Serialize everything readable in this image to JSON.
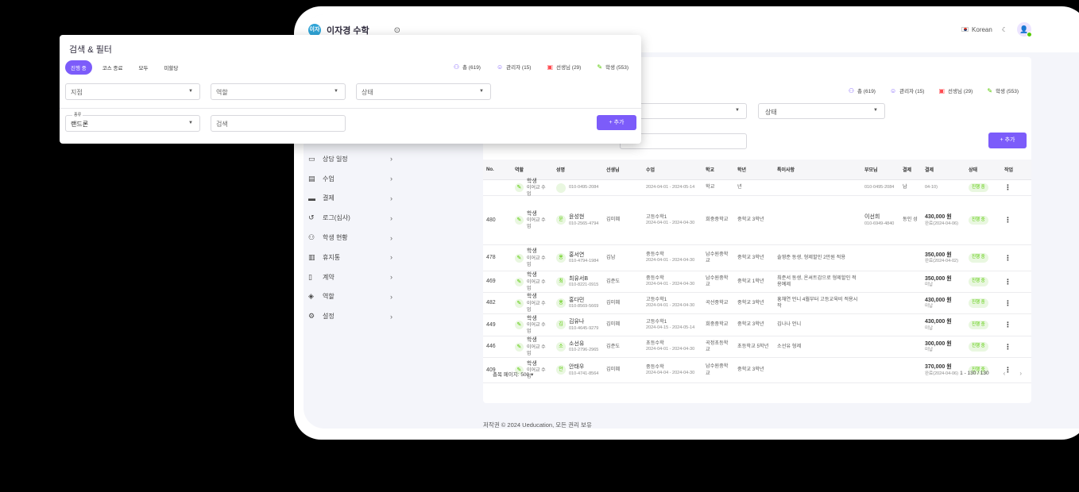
{
  "app": {
    "title": "이자경 수학",
    "logo_text": "이자경",
    "language": "Korean",
    "footer": "저작권 © 2024 Ueducation, 모든 권리 보유"
  },
  "colors": {
    "accent": "#7c5cfa",
    "success": "#56ca00",
    "error": "#ff4c51",
    "info": "#16b1ff"
  },
  "sidebar": {
    "items": [
      {
        "label": "상담 일정",
        "icon": "calendar-icon"
      },
      {
        "label": "수업",
        "icon": "book-icon"
      },
      {
        "label": "결제",
        "icon": "card-icon"
      },
      {
        "label": "로그(심사)",
        "icon": "history-icon"
      },
      {
        "label": "학생 현황",
        "icon": "users-icon"
      },
      {
        "label": "휴지통",
        "icon": "trash-icon"
      },
      {
        "label": "계약",
        "icon": "contract-icon"
      },
      {
        "label": "역할",
        "icon": "shield-icon"
      },
      {
        "label": "설정",
        "icon": "gear-icon"
      }
    ]
  },
  "stats": {
    "total": "총 (619)",
    "admin": "관리자 (15)",
    "teacher": "선생님 (29)",
    "student": "학생 (553)"
  },
  "filter_card": {
    "title": "검색 & 필터",
    "tabs": [
      "진행 중",
      "코스 종료",
      "모두",
      "미할당"
    ],
    "branch_placeholder": "지점",
    "role_placeholder": "역할",
    "status_placeholder": "상태",
    "type_label": "종류",
    "type_value": "랜드론",
    "search_placeholder": "검색",
    "add_label": "+ 추가"
  },
  "back_filters": {
    "status_placeholder": "상태",
    "add_label": "+ 추가"
  },
  "table": {
    "headers": [
      "No.",
      "역할",
      "성명",
      "선생님",
      "수업",
      "학교",
      "학년",
      "특이사항",
      "부모님",
      "결제",
      "결제",
      "상태",
      "작업"
    ],
    "rows": [
      {
        "no": "",
        "role": "학생",
        "role_sub": "이어교 수업",
        "initial": "",
        "name": "",
        "phone": "010-0495-2084",
        "teacher": "",
        "class": "",
        "class_date": "2024-04-01 - 2024-05-14",
        "school": "학교",
        "grade": "년",
        "note": "",
        "parent": "",
        "parent_phone": "010-0495-2084",
        "pay": "남",
        "amount": "",
        "amount_sub": "04-10)",
        "status": "진행 중"
      },
      {
        "no": "480",
        "role": "학생",
        "role_sub": "이어교 수업",
        "initial": "윤",
        "name": "윤성현",
        "phone": "010-2565-4794",
        "teacher": "김미혜",
        "class": "고등수학1",
        "class_date": "2024-04-01 - 2024-04-30",
        "school": "희중중학교",
        "grade": "중학교 3학년",
        "note": "",
        "parent": "이선희",
        "parent_phone": "010-6949-4840",
        "pay": "동인 성",
        "amount": "430,000 원",
        "amount_sub": "완료(2024-04-06)",
        "status": "진행 중"
      },
      {
        "no": "478",
        "role": "학생",
        "role_sub": "이어교 수업",
        "initial": "홍",
        "name": "홍서연",
        "phone": "010-4794-1984",
        "teacher": "김남",
        "class": "중등수학",
        "class_date": "2024-04-01 - 2024-04-30",
        "school": "남수원중학교",
        "grade": "중학교 3학년",
        "note": "솔영준 동생, 형제할인 2만원 적용",
        "parent": "",
        "parent_phone": "",
        "pay": "",
        "amount": "350,000 원",
        "amount_sub": "완료(2024-04-02)",
        "status": "진행 중"
      },
      {
        "no": "469",
        "role": "학생",
        "role_sub": "이어교 수업",
        "initial": "최",
        "name": "최유서B",
        "phone": "010-8221-0915",
        "teacher": "김준도",
        "class": "중등수학",
        "class_date": "2024-04-01 - 2024-04-30",
        "school": "남수원중학교",
        "grade": "중학교 1학년",
        "note": "최준서 동생, 온셔트감으로 형제할인 적용예제",
        "parent": "",
        "parent_phone": "",
        "pay": "",
        "amount": "350,000 원",
        "amount_sub": "미납",
        "status": "진행 중"
      },
      {
        "no": "482",
        "role": "학생",
        "role_sub": "이어교 수업",
        "initial": "홍",
        "name": "홍다민",
        "phone": "010-8569-5669",
        "teacher": "김미혜",
        "class": "고등수학1",
        "class_date": "2024-04-01 - 2024-04-30",
        "school": "곡선중학교",
        "grade": "중학교 3학년",
        "note": "홍채연 언니 4월부터 고등교육비 적용시작",
        "parent": "",
        "parent_phone": "",
        "pay": "",
        "amount": "430,000 원",
        "amount_sub": "미납",
        "status": "진행 중"
      },
      {
        "no": "449",
        "role": "학생",
        "role_sub": "이어교 수업",
        "initial": "김",
        "name": "김유나",
        "phone": "010-4645-9279",
        "teacher": "김미혜",
        "class": "고등수학1",
        "class_date": "2024-04-15 - 2024-05-14",
        "school": "희중중학교",
        "grade": "중학교 3학년",
        "note": "김나나 언니",
        "parent": "",
        "parent_phone": "",
        "pay": "",
        "amount": "430,000 원",
        "amount_sub": "미납",
        "status": "진행 중"
      },
      {
        "no": "446",
        "role": "학생",
        "role_sub": "이어교 수업",
        "initial": "소",
        "name": "소선유",
        "phone": "010-2796-2965",
        "teacher": "김준도",
        "class": "초등수학",
        "class_date": "2024-04-01 - 2024-04-30",
        "school": "곡정초등학교",
        "grade": "초등학교 5학년",
        "note": "소선유 형제",
        "parent": "",
        "parent_phone": "",
        "pay": "",
        "amount": "300,000 원",
        "amount_sub": "미납",
        "status": "진행 중"
      },
      {
        "no": "409",
        "role": "학생",
        "role_sub": "이어교 수업",
        "initial": "안",
        "name": "안태우",
        "phone": "010-4741-8564",
        "teacher": "김미혜",
        "class": "중등수학",
        "class_date": "2024-04-04 - 2024-04-30",
        "school": "남수원중학교",
        "grade": "중학교 3학년",
        "note": "",
        "parent": "",
        "parent_phone": "",
        "pay": "",
        "amount": "370,000 원",
        "amount_sub": "완료(2024-04-06)",
        "status": "진행 중"
      }
    ],
    "rows_per_page": "총목 페이지: 500",
    "pagination": "1 - 130 / 130"
  }
}
